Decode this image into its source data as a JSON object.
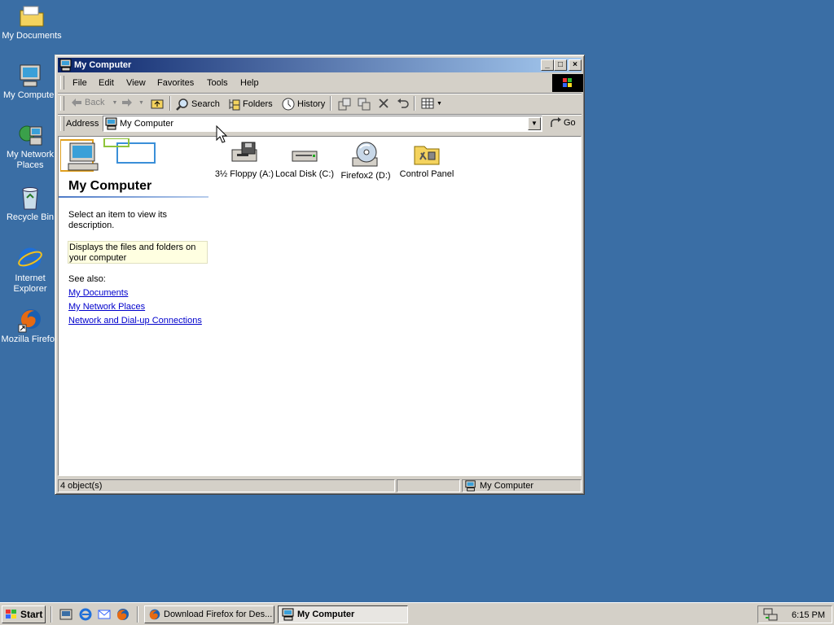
{
  "desktop": {
    "icons": [
      {
        "label": "My Documents"
      },
      {
        "label": "My Computer"
      },
      {
        "label": "My Network Places"
      },
      {
        "label": "Recycle Bin"
      },
      {
        "label": "Internet Explorer"
      },
      {
        "label": "Mozilla Firefox"
      }
    ]
  },
  "window": {
    "title": "My Computer",
    "menu": [
      "File",
      "Edit",
      "View",
      "Favorites",
      "Tools",
      "Help"
    ],
    "toolbar": {
      "back": "Back",
      "search": "Search",
      "folders": "Folders",
      "history": "History"
    },
    "address": {
      "label": "Address",
      "value": "My Computer",
      "go": "Go"
    },
    "left_pane": {
      "title": "My Computer",
      "hint": "Select an item to view its description.",
      "description": "Displays the files and folders on your computer",
      "see_also": "See also:",
      "links": [
        "My Documents",
        "My Network Places",
        "Network and Dial-up Connections"
      ]
    },
    "items": [
      {
        "label": "3½ Floppy (A:)"
      },
      {
        "label": "Local Disk (C:)"
      },
      {
        "label": "Firefox2 (D:)"
      },
      {
        "label": "Control Panel"
      }
    ],
    "status": {
      "count": "4 object(s)",
      "zone": "My Computer"
    }
  },
  "taskbar": {
    "start": "Start",
    "tasks": [
      {
        "label": "Download Firefox for Des..."
      },
      {
        "label": "My Computer"
      }
    ],
    "clock": "6:15 PM"
  },
  "colors": {
    "desktop": "#3a6ea5",
    "titlebar": "#0a246a",
    "link": "#0000cc"
  }
}
